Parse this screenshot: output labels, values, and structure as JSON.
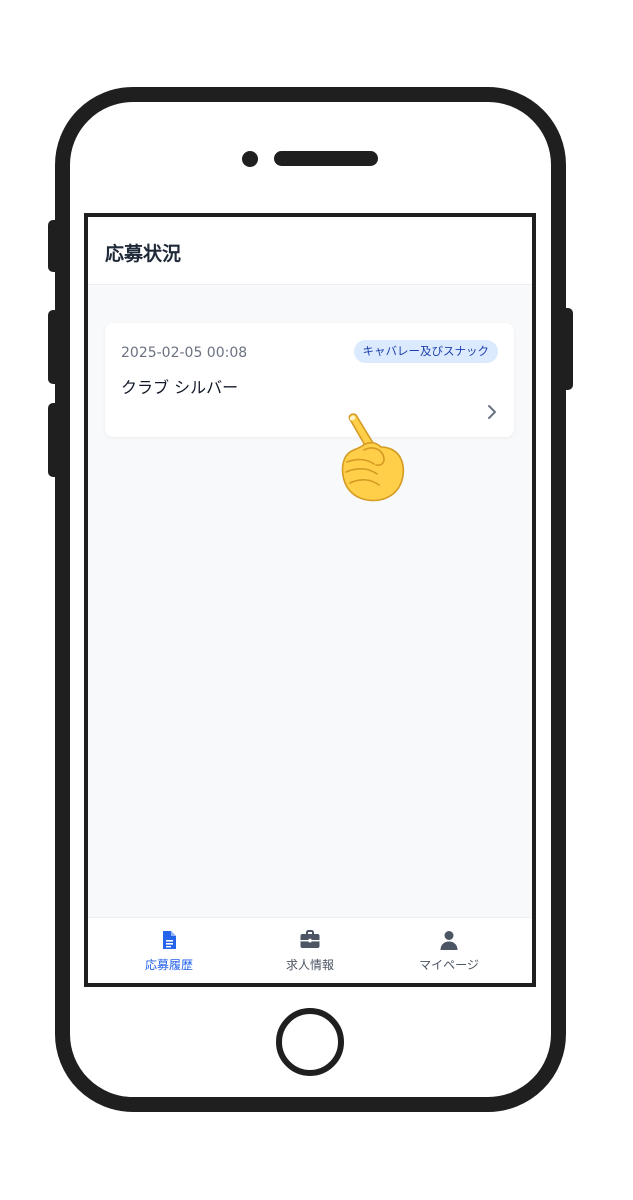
{
  "header": {
    "title": "応募状況"
  },
  "application": {
    "date": "2025-02-05 00:08",
    "category": "キャバレー及びスナック",
    "name": "クラブ シルバー"
  },
  "bottom_nav": {
    "items": [
      {
        "label": "応募履歴",
        "icon": "document-icon",
        "active": true
      },
      {
        "label": "求人情報",
        "icon": "briefcase-icon",
        "active": false
      },
      {
        "label": "マイページ",
        "icon": "user-icon",
        "active": false
      }
    ]
  },
  "colors": {
    "accent": "#2563eb",
    "badge_background": "#dbeafe",
    "badge_text": "#1e40af",
    "screen_background": "#f8f9fb",
    "frame": "#1f1f1f"
  }
}
